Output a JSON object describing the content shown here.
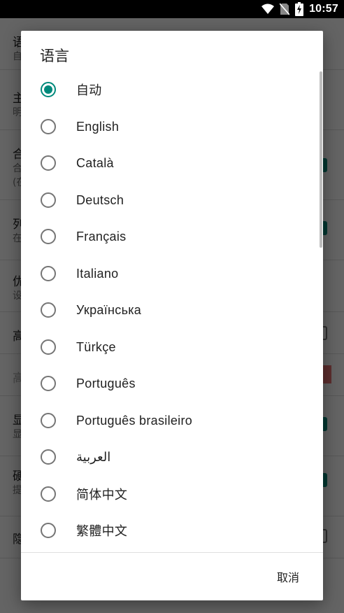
{
  "status_bar": {
    "time": "10:57",
    "icons": [
      "wifi-icon",
      "no-sim-icon",
      "battery-charging-icon"
    ]
  },
  "background": {
    "rows": [
      {
        "title": "语",
        "subtitle": "自",
        "control": "none"
      },
      {
        "title": "主",
        "subtitle": "明",
        "control": "none"
      },
      {
        "title": "合",
        "subtitle": "合",
        "subtitle2": "(在",
        "control": "checkbox-checked"
      },
      {
        "title": "列",
        "subtitle": "在",
        "control": "checkbox-checked"
      },
      {
        "title": "优",
        "subtitle": "设",
        "control": "none"
      },
      {
        "title": "高",
        "control": "checkbox-unchecked"
      },
      {
        "title": "高",
        "control": "warning-block",
        "disabled": true
      },
      {
        "title": "显",
        "subtitle": "显",
        "control": "checkbox-checked"
      },
      {
        "title": "硬",
        "subtitle": "提",
        "control": "checkbox-checked"
      },
      {
        "title": "隐",
        "control": "checkbox-unchecked"
      }
    ]
  },
  "dialog": {
    "title": "语言",
    "selected_index": 0,
    "options": [
      "自动",
      "English",
      "Català",
      "Deutsch",
      "Français",
      "Italiano",
      "Українська",
      "Türkçe",
      "Português",
      "Português brasileiro",
      "العربية",
      "简体中文",
      "繁體中文"
    ],
    "cancel_label": "取消"
  },
  "colors": {
    "accent": "#00897b",
    "scrim": "#000000",
    "warning": "#e57373"
  }
}
